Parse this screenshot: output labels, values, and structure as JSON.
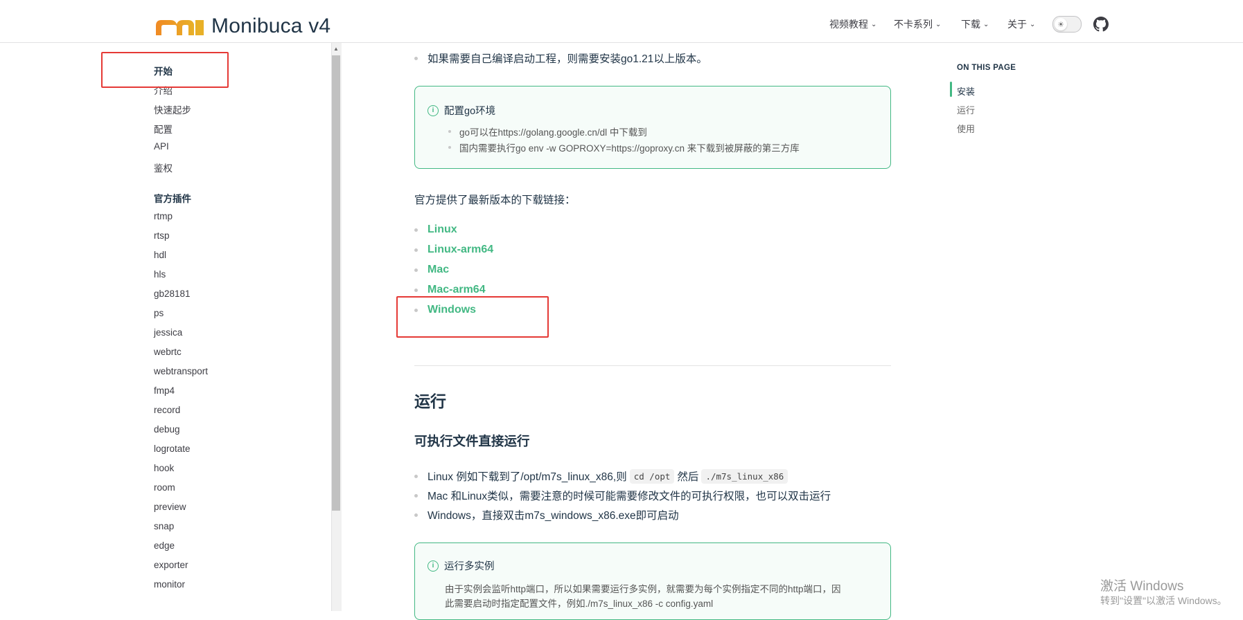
{
  "header": {
    "brand": "Monibuca v4",
    "nav": [
      {
        "label": "视频教程"
      },
      {
        "label": "不卡系列"
      },
      {
        "label": "下载"
      },
      {
        "label": "关于"
      }
    ]
  },
  "sidebar": {
    "section1_title": "开始",
    "section1_items": [
      "介绍",
      "快速起步",
      "配置",
      "API",
      "鉴权"
    ],
    "section2_title": "官方插件",
    "section2_items": [
      "rtmp",
      "rtsp",
      "hdl",
      "hls",
      "gb28181",
      "ps",
      "jessica",
      "webrtc",
      "webtransport",
      "fmp4",
      "record",
      "debug",
      "logrotate",
      "hook",
      "room",
      "preview",
      "snap",
      "edge",
      "exporter",
      "monitor"
    ]
  },
  "content": {
    "top_bullet": "如果需要自己编译启动工程，则需要安装go1.21以上版本。",
    "tip1": {
      "title": "配置go环境",
      "items": [
        "go可以在https://golang.google.cn/dl 中下载到",
        "国内需要执行go env -w GOPROXY=https://goproxy.cn 来下载到被屏蔽的第三方库"
      ]
    },
    "download_intro": "官方提供了最新版本的下载链接：",
    "download_links": [
      "Linux",
      "Linux-arm64",
      "Mac",
      "Mac-arm64",
      "Windows"
    ],
    "h2_run": "运行",
    "h3_exec": "可执行文件直接运行",
    "run_bullets": {
      "b1_text1": "Linux 例如下载到了/opt/m7s_linux_x86,则",
      "b1_code1": "cd /opt",
      "b1_text2": "然后",
      "b1_code2": "./m7s_linux_x86",
      "b2": "Mac 和Linux类似，需要注意的时候可能需要修改文件的可执行权限，也可以双击运行",
      "b3": "Windows，直接双击m7s_windows_x86.exe即可启动"
    },
    "tip2": {
      "title": "运行多实例",
      "line1": "由于实例会监听http端口，所以如果需要运行多实例，就需要为每个实例指定不同的http端口，因",
      "line2": "此需要启动时指定配置文件，例如./m7s_linux_x86 -c config.yaml"
    }
  },
  "outline": {
    "title": "ON THIS PAGE",
    "items": [
      "安装",
      "运行",
      "使用"
    ]
  },
  "watermark": {
    "line1": "激活 Windows",
    "line2": "转到\"设置\"以激活 Windows。"
  },
  "colors": {
    "accent": "#42b883",
    "annotation": "#e53935"
  }
}
